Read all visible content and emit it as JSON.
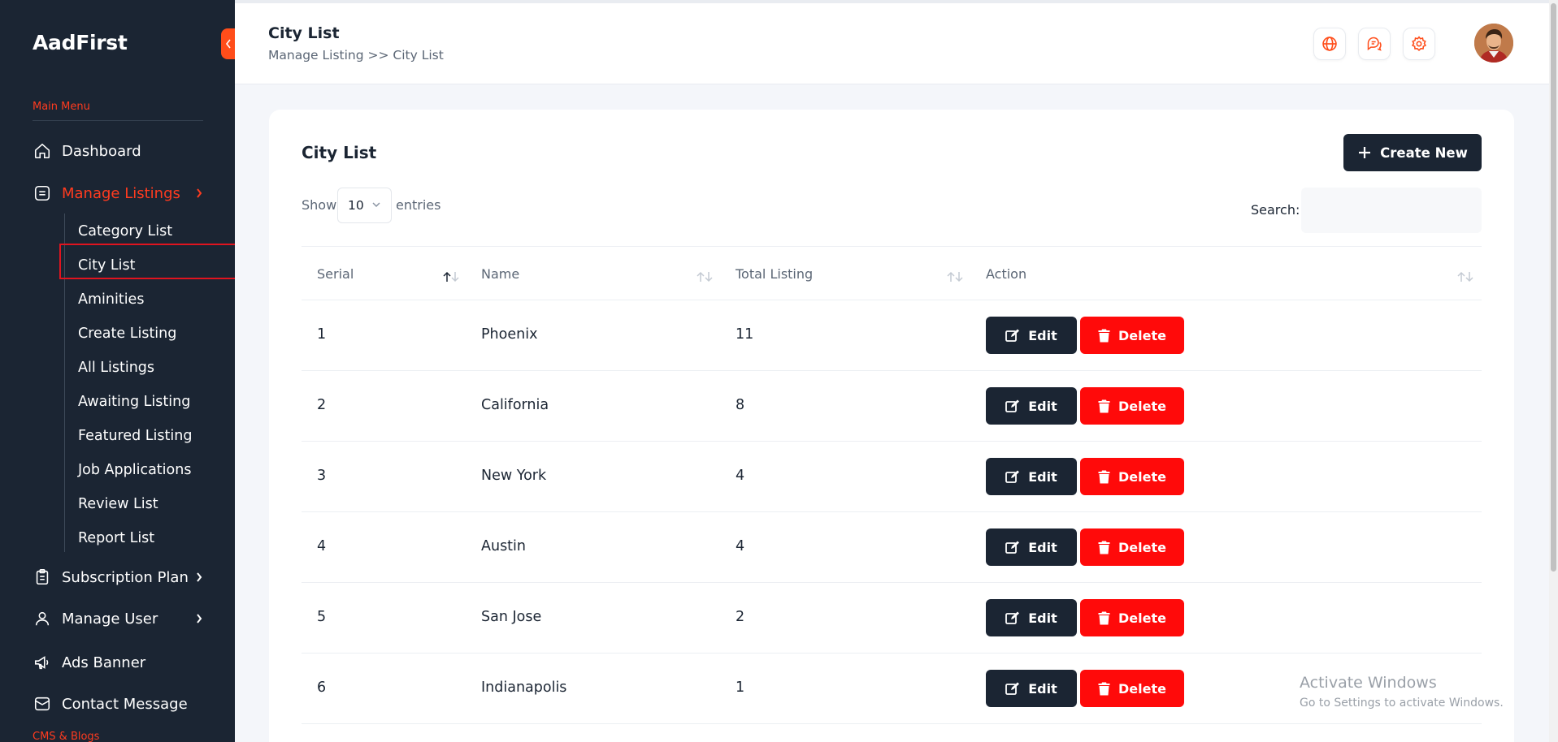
{
  "app": {
    "brand": "AadFirst"
  },
  "sidebar": {
    "main_menu_label": "Main Menu",
    "items": [
      {
        "label": "Dashboard",
        "icon": "home-icon"
      },
      {
        "label": "Manage Listings",
        "icon": "list-icon",
        "active": true
      },
      {
        "label": "Subscription Plan",
        "icon": "clipboard-icon"
      },
      {
        "label": "Manage User",
        "icon": "user-icon"
      },
      {
        "label": "Ads Banner",
        "icon": "megaphone-icon"
      },
      {
        "label": "Contact Message",
        "icon": "mail-icon"
      }
    ],
    "sub_items": [
      "Category List",
      "City List",
      "Aminities",
      "Create Listing",
      "All Listings",
      "Awaiting Listing",
      "Featured Listing",
      "Job Applications",
      "Review List",
      "Report List"
    ],
    "cms_label": "CMS & Blogs"
  },
  "header": {
    "title": "City List",
    "breadcrumb": "Manage Listing >> City List",
    "icons": [
      "globe-icon",
      "chat-icon",
      "gear-icon"
    ]
  },
  "card": {
    "title": "City List",
    "create_label": "Create New",
    "show_label": "Show",
    "entries_value": "10",
    "entries_label": "entries",
    "search_label": "Search:",
    "search_value": ""
  },
  "table": {
    "columns": [
      "Serial",
      "Name",
      "Total Listing",
      "Action"
    ],
    "edit_label": "Edit",
    "delete_label": "Delete",
    "rows": [
      {
        "serial": "1",
        "name": "Phoenix",
        "total": "11"
      },
      {
        "serial": "2",
        "name": "California",
        "total": "8"
      },
      {
        "serial": "3",
        "name": "New York",
        "total": "4"
      },
      {
        "serial": "4",
        "name": "Austin",
        "total": "4"
      },
      {
        "serial": "5",
        "name": "San Jose",
        "total": "2"
      },
      {
        "serial": "6",
        "name": "Indianapolis",
        "total": "1"
      }
    ]
  },
  "watermark": {
    "line1": "Activate Windows",
    "line2": "Go to Settings to activate Windows."
  },
  "colors": {
    "sidebar": "#1b2533",
    "accent": "#ff3b1f",
    "danger": "#ff0a0a",
    "dark_button": "#1b2533"
  }
}
